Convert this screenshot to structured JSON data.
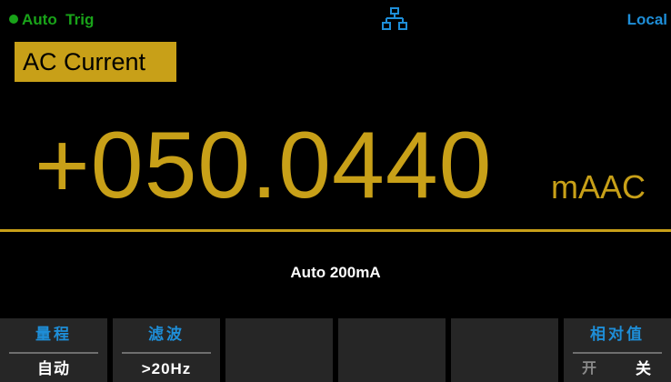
{
  "status": {
    "trigger_mode": "Auto  Trig",
    "remote_status": "Local",
    "network_icon": "network-icon"
  },
  "measurement": {
    "function_label": "AC Current",
    "reading": "+050.0440",
    "unit": "mAAC",
    "range_info": "Auto  200mA"
  },
  "softkeys": [
    {
      "title": "量程",
      "value": "自动"
    },
    {
      "title": "滤波",
      "value": ">20Hz"
    },
    {
      "title": "",
      "value": ""
    },
    {
      "title": "",
      "value": ""
    },
    {
      "title": "",
      "value": ""
    },
    {
      "title": "相对值",
      "option_on": "开",
      "option_off": "关"
    }
  ],
  "colors": {
    "accent": "#c8a018",
    "trigger": "#19a319",
    "status_blue": "#1e8ed8",
    "softkey_bg": "#262626"
  }
}
